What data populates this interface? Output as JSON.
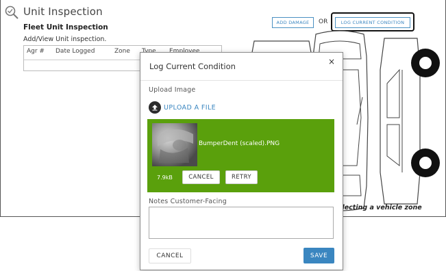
{
  "app": {
    "title": "Unit Inspection",
    "subtitle": "Fleet Unit Inspection",
    "description": "Add/View Unit inspection.",
    "table": {
      "columns": [
        "Agr #",
        "Date Logged",
        "Zone",
        "Type",
        "Employee"
      ]
    },
    "add_damage_label": "ADD DAMAGE",
    "or_label": "OR",
    "log_condition_label": "LOG CURRENT CONDITION",
    "zone_hint": "electing a vehicle zone"
  },
  "modal": {
    "title": "Log Current Condition",
    "close_label": "×",
    "upload_label": "Upload Image",
    "upload_button": "UPLOAD A FILE",
    "file": {
      "name": "BumperDent (scaled).PNG",
      "size": "7.9kB",
      "cancel_label": "CANCEL",
      "retry_label": "RETRY"
    },
    "notes_label": "Notes Customer-Facing",
    "notes_value": "",
    "cancel_label": "CANCEL",
    "save_label": "SAVE"
  },
  "colors": {
    "accent": "#3a86c0",
    "file_card_bg": "#5aa00c",
    "border": "#555555"
  },
  "icons": [
    "magnifier-icon",
    "upload-icon",
    "close-icon",
    "vehicle-diagram"
  ]
}
